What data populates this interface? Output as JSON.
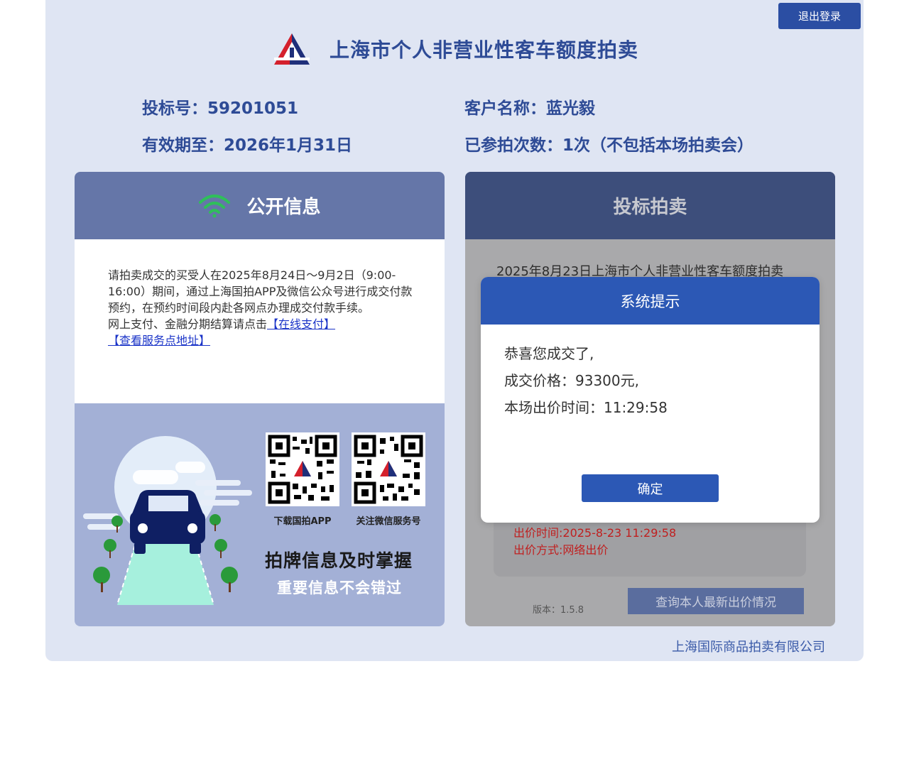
{
  "header": {
    "logout_label": "退出登录",
    "title": "上海市个人非营业性客车额度拍卖"
  },
  "bidder": {
    "bid_number": "投标号：59201051",
    "valid_until": "有效期至：2026年1月31日",
    "customer_name": "客户名称：蓝光毅",
    "participation": "已参拍次数：1次（不包括本场拍卖会）"
  },
  "public_panel": {
    "title": "公开信息",
    "notice_text": "请拍卖成交的买受人在2025年8月24日～9月2日（9:00-16:00）期间，通过上海国拍APP及微信公众号进行成交付款预约，在预约时间段内赴各网点办理成交付款手续。",
    "notice_pay_prefix": "网上支付、金融分期结算请点击",
    "pay_link": "【在线支付】",
    "service_link": "【查看服务点地址】",
    "qr_app_label": "下载国拍APP",
    "qr_wechat_label": "关注微信服务号",
    "slogan_main": "拍牌信息及时掌握",
    "slogan_sub": "重要信息不会错过"
  },
  "bid_panel": {
    "title": "投标拍卖",
    "auction_title": "2025年8月23日上海市个人非营业性客车额度拍卖",
    "bid_time": "出价时间:2025-8-23 11:29:58",
    "bid_method": "出价方式:网络出价",
    "version": "版本：1.5.8",
    "query_button": "查询本人最新出价情况"
  },
  "modal": {
    "title": "系统提示",
    "line1": "恭喜您成交了,",
    "line2": "成交价格：93300元,",
    "line3": "本场出价时间：11:29:58",
    "ok_button": "确定"
  },
  "footer": {
    "company": "上海国际商品拍卖有限公司"
  },
  "colors": {
    "brand_blue": "#2e4b96",
    "button_blue": "#2c58b5",
    "wifi_green": "#2fbf5a",
    "link_blue": "#1b34c8",
    "alert_red": "#c01f1f"
  },
  "icons": [
    "auction-logo-icon",
    "wifi-icon",
    "qr-code-app-icon",
    "qr-code-wechat-icon",
    "car-illustration-icon"
  ]
}
